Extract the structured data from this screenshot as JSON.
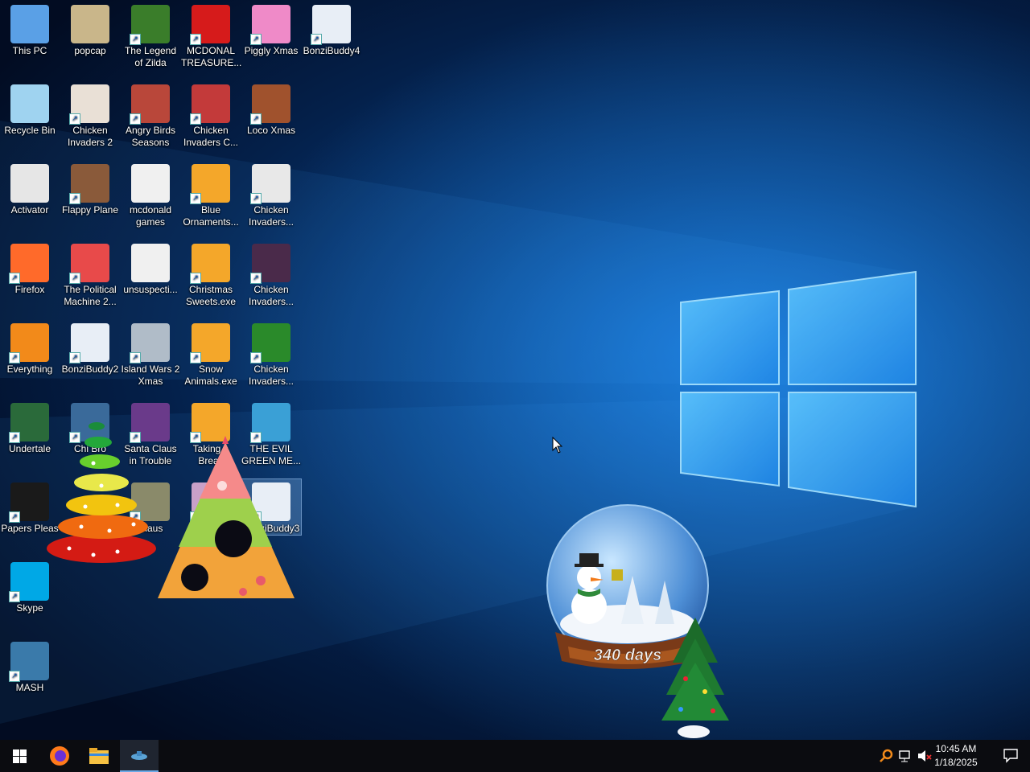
{
  "desktop": {
    "icons": [
      {
        "name": "icon-this-pc",
        "label": "This PC"
      },
      {
        "name": "icon-popcap",
        "label": "popcap"
      },
      {
        "name": "icon-legend-of-zilda",
        "label": "The Legend of Zilda"
      },
      {
        "name": "icon-mcdonal-treasure",
        "label": "MCDONAL TREASURE..."
      },
      {
        "name": "icon-piggly-xmas",
        "label": "Piggly Xmas"
      },
      {
        "name": "icon-bonzibuddy4",
        "label": "BonziBuddy4"
      },
      {
        "name": "icon-recycle-bin",
        "label": "Recycle Bin"
      },
      {
        "name": "icon-chicken-invaders-2",
        "label": "Chicken Invaders 2"
      },
      {
        "name": "icon-angry-birds-seasons",
        "label": "Angry Birds Seasons"
      },
      {
        "name": "icon-chicken-invaders-c",
        "label": "Chicken Invaders C..."
      },
      {
        "name": "icon-loco-xmas",
        "label": "Loco Xmas"
      },
      {
        "name": "icon-activator",
        "label": "Activator"
      },
      {
        "name": "icon-flappy-plane",
        "label": "Flappy Plane"
      },
      {
        "name": "icon-mcdonald-games",
        "label": "mcdonald games"
      },
      {
        "name": "icon-blue-ornaments",
        "label": "Blue Ornaments..."
      },
      {
        "name": "icon-chicken-invaders-r3c5",
        "label": "Chicken Invaders..."
      },
      {
        "name": "icon-firefox",
        "label": "Firefox"
      },
      {
        "name": "icon-political-machine",
        "label": "The Political Machine 2..."
      },
      {
        "name": "icon-unsuspecting",
        "label": "unsuspecti..."
      },
      {
        "name": "icon-christmas-sweets",
        "label": "Christmas Sweets.exe"
      },
      {
        "name": "icon-chicken-invaders-r4c5",
        "label": "Chicken Invaders..."
      },
      {
        "name": "icon-everything",
        "label": "Everything"
      },
      {
        "name": "icon-bonzibuddy2",
        "label": "BonziBuddy2"
      },
      {
        "name": "icon-island-wars-2",
        "label": "Island Wars 2 Xmas"
      },
      {
        "name": "icon-snow-animals",
        "label": "Snow Animals.exe"
      },
      {
        "name": "icon-chicken-invaders-r5c5",
        "label": "Chicken Invaders..."
      },
      {
        "name": "icon-undertale",
        "label": "Undertale"
      },
      {
        "name": "icon-chicken-broth",
        "label": "Chi Bro"
      },
      {
        "name": "icon-santa-claus-trouble",
        "label": "Santa Claus in Trouble"
      },
      {
        "name": "icon-taking-a-break",
        "label": "Taking a Break"
      },
      {
        "name": "icon-evil-green-me",
        "label": "THE EVIL GREEN ME..."
      },
      {
        "name": "icon-papers-please",
        "label": "Papers Pleas"
      },
      {
        "name": "icon-santa-claus-2",
        "label": "Claus"
      },
      {
        "name": "icon-xmas-crisis",
        "label": "mas risis"
      },
      {
        "name": "icon-bonzibuddy3",
        "label": "BonziBuddy3"
      },
      {
        "name": "icon-skype",
        "label": "Skype"
      },
      {
        "name": "icon-mash",
        "label": "MASH"
      }
    ]
  },
  "snowglobe": {
    "countdown": "340 days"
  },
  "taskbar": {
    "items": [
      {
        "name": "start-button",
        "icon": "windows-logo-icon"
      },
      {
        "name": "taskbar-firefox",
        "icon": "firefox-icon"
      },
      {
        "name": "taskbar-file-explorer",
        "icon": "folder-icon"
      },
      {
        "name": "taskbar-mash",
        "icon": "mash-icon"
      }
    ],
    "time": "10:45 AM",
    "date": "1/18/2025"
  },
  "colors": {
    "accent": "#0078d7",
    "taskbar": "#0b0c10"
  }
}
